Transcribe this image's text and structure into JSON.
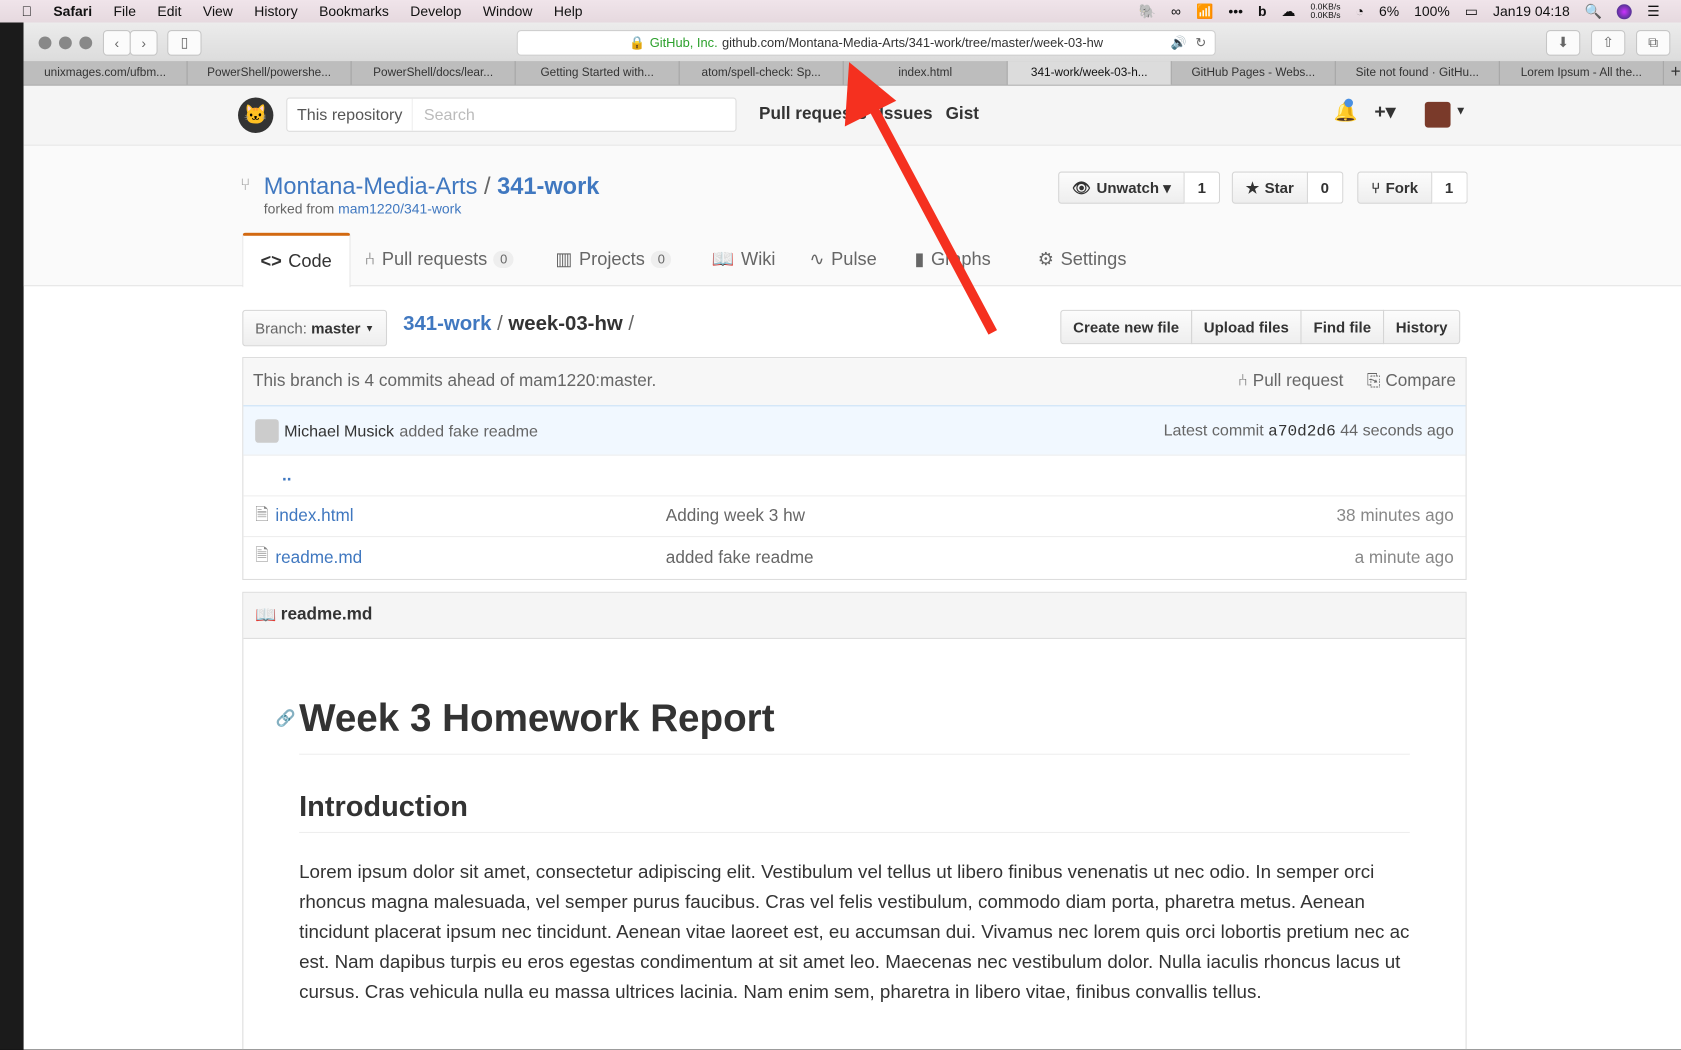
{
  "menubar": {
    "app": "Safari",
    "items": [
      "File",
      "Edit",
      "View",
      "History",
      "Bookmarks",
      "Develop",
      "Window",
      "Help"
    ],
    "status": {
      "net_up": "0.0KB/s",
      "net_down": "0.0KB/s",
      "cpu": "6%",
      "battery": "100%",
      "datetime": "Jan19 04:18"
    }
  },
  "browser": {
    "url_org": "GitHub, Inc.",
    "url": "github.com/Montana-Media-Arts/341-work/tree/master/week-03-hw",
    "tabs": [
      "unixmages.com/ufbm...",
      "PowerShell/powershe...",
      "PowerShell/docs/lear...",
      "Getting Started with...",
      "atom/spell-check: Sp...",
      "index.html",
      "341-work/week-03-h...",
      "GitHub Pages - Webs...",
      "Site not found · GitHu...",
      "Lorem Ipsum - All the..."
    ],
    "active_tab": 6,
    "new_tab": "+"
  },
  "header": {
    "search_scope": "This repository",
    "search_placeholder": "Search",
    "nav": [
      "Pull requests",
      "Issues",
      "Gist"
    ],
    "plus": "+▾"
  },
  "repo": {
    "owner": "Montana-Media-Arts",
    "sep": "/",
    "name": "341-work",
    "forked_label": "forked from",
    "forked_from": "mam1220/341-work",
    "actions": [
      {
        "label": "Unwatch ▾",
        "count": "1"
      },
      {
        "label": "Star",
        "count": "0"
      },
      {
        "label": "Fork",
        "count": "1"
      }
    ]
  },
  "tabs": [
    {
      "label": "Code"
    },
    {
      "label": "Pull requests",
      "count": "0"
    },
    {
      "label": "Projects",
      "count": "0"
    },
    {
      "label": "Wiki"
    },
    {
      "label": "Pulse"
    },
    {
      "label": "Graphs"
    },
    {
      "label": "Settings"
    }
  ],
  "branch": {
    "label": "Branch:",
    "value": "master"
  },
  "breadcrumb": {
    "root": "341-work",
    "sep": "/",
    "dir": "week-03-hw",
    "trail": "/"
  },
  "file_buttons": [
    "Create new file",
    "Upload files",
    "Find file",
    "History"
  ],
  "ahead": {
    "text": "This branch is 4 commits ahead of mam1220:master.",
    "pull_request": "Pull request",
    "compare": "Compare"
  },
  "commit": {
    "author": "Michael Musick",
    "message": "added fake readme",
    "latest_label": "Latest commit",
    "sha": "a70d2d6",
    "age": "44 seconds ago"
  },
  "files": {
    "parent": "..",
    "items": [
      {
        "name": "index.html",
        "message": "Adding week 3 hw",
        "age": "38 minutes ago"
      },
      {
        "name": "readme.md",
        "message": "added fake readme",
        "age": "a minute ago"
      }
    ]
  },
  "readme": {
    "filename": "readme.md",
    "h1": "Week 3 Homework Report",
    "h2": "Introduction",
    "paragraph": "Lorem ipsum dolor sit amet, consectetur adipiscing elit. Vestibulum vel tellus ut libero finibus venenatis ut nec odio. In semper orci rhoncus magna malesuada, vel semper purus faucibus. Cras vel felis vestibulum, commodo diam porta, pharetra metus. Aenean tincidunt placerat ipsum nec tincidunt. Aenean vitae laoreet est, eu accumsan dui. Vivamus nec lorem quis orci lobortis pretium nec ac est. Nam dapibus turpis eu eros egestas condimentum at sit amet leo. Maecenas nec vestibulum dolor. Nulla iaculis rhoncus lacus ut cursus. Cras vehicula nulla eu massa ultrices lacinia. Nam enim sem, pharetra in libero vitae, finibus convallis tellus."
  },
  "colors": {
    "link": "#4078c0",
    "tab_accent": "#d26911",
    "annotation_arrow": "#f5301f"
  }
}
